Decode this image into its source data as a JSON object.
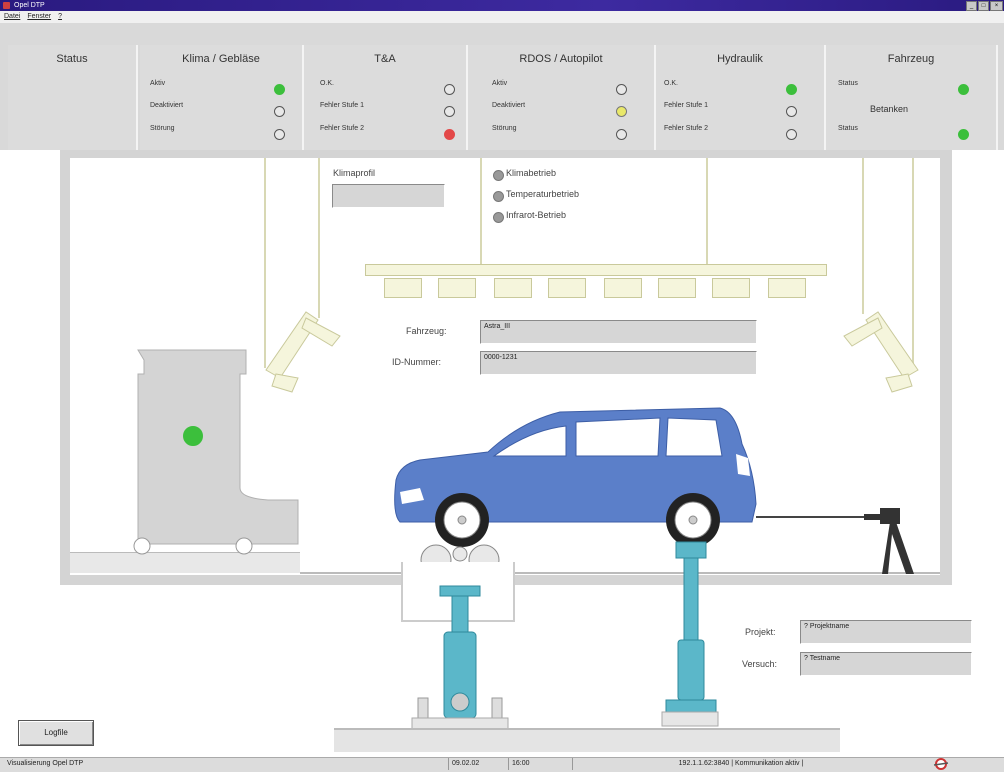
{
  "window": {
    "title": "Opel DTP"
  },
  "menu": [
    "Datei",
    "Fenster",
    "?"
  ],
  "panels": [
    {
      "title": "Status",
      "rows": []
    },
    {
      "title": "Klima / Gebläse",
      "rows": [
        {
          "label": "Aktiv",
          "led": "green"
        },
        {
          "label": "Deaktiviert",
          "led": "off"
        },
        {
          "label": "Störung",
          "led": "off"
        }
      ]
    },
    {
      "title": "T&A",
      "rows": [
        {
          "label": "O.K.",
          "led": "off"
        },
        {
          "label": "Fehler Stufe 1",
          "led": "off"
        },
        {
          "label": "Fehler Stufe 2",
          "led": "red"
        }
      ]
    },
    {
      "title": "RDOS / Autopilot",
      "rows": [
        {
          "label": "Aktiv",
          "led": "off"
        },
        {
          "label": "Deaktiviert",
          "led": "yellow"
        },
        {
          "label": "Störung",
          "led": "off"
        }
      ]
    },
    {
      "title": "Hydraulik",
      "rows": [
        {
          "label": "O.K.",
          "led": "green"
        },
        {
          "label": "Fehler Stufe 1",
          "led": "off"
        },
        {
          "label": "Fehler Stufe 2",
          "led": "off"
        }
      ]
    },
    {
      "title": "Fahrzeug",
      "subtitle": "Betanken",
      "rows": [
        {
          "label": "Status",
          "led": "green"
        },
        {
          "label": "Status",
          "led": "green"
        }
      ]
    }
  ],
  "klima": {
    "label": "Klimaprofil",
    "value": ""
  },
  "modes": [
    "Klimabetrieb",
    "Temperaturbetrieb",
    "Infrarot-Betrieb"
  ],
  "vehicle": {
    "label": "Fahrzeug:",
    "value": "Astra_III"
  },
  "idnum": {
    "label": "ID-Nummer:",
    "value": "0000-1231"
  },
  "project": {
    "label": "Projekt:",
    "value": "? Projektname"
  },
  "trial": {
    "label": "Versuch:",
    "value": "? Testname"
  },
  "logfile_button": "Logfile",
  "statusbar": {
    "left": "Visualisierung Opel DTP",
    "date": "09.02.02",
    "time": "16:00",
    "connection": "192.1.1.62:3840 | Kommunikation aktiv |"
  },
  "colors": {
    "car": "#5b7fc9",
    "hydraulic": "#5bb7c9",
    "led_green": "#3cbf3c",
    "led_red": "#e34848",
    "led_yellow": "#e9e86a"
  }
}
